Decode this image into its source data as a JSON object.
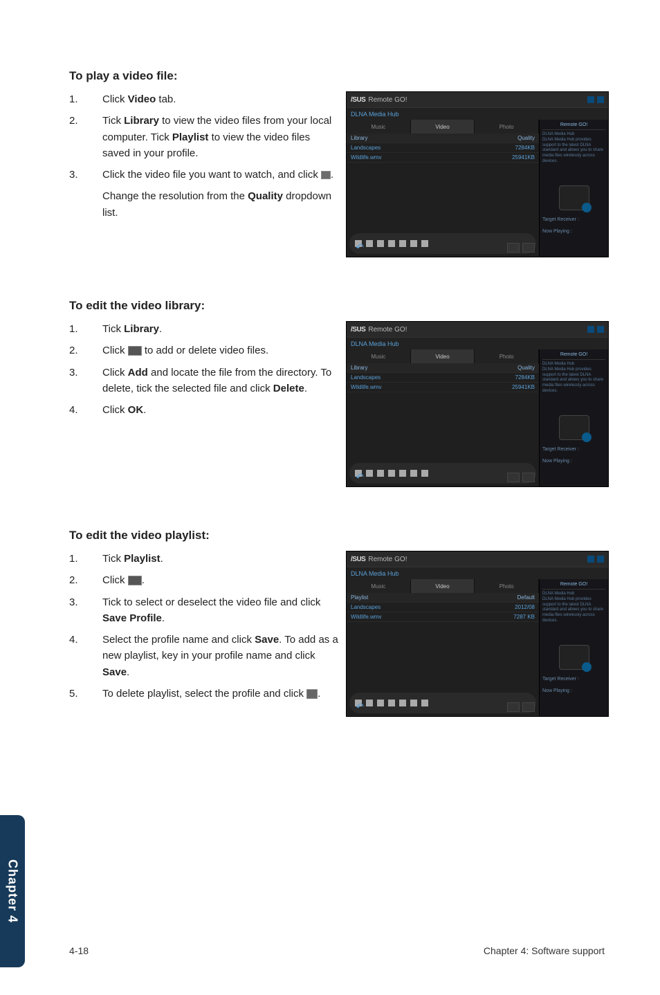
{
  "sidetab": "Chapter 4",
  "footer": {
    "left": "4-18",
    "right": "Chapter 4: Software support"
  },
  "sec1": {
    "heading": "To play a video file:",
    "items": [
      {
        "n": "1.",
        "pre": "Click ",
        "b1": "Video",
        "post": " tab."
      },
      {
        "n": "2.",
        "pre": "Tick ",
        "b1": "Library",
        "mid1": " to view the video files from your local computer. Tick ",
        "b2": "Playlist",
        "post": " to view the video files saved in your profile."
      },
      {
        "n": "3.",
        "pre": "Click the video file you want to watch, and click ",
        "icon": "play",
        "post": "."
      }
    ],
    "extra": {
      "pre": "Change the resolution from the ",
      "b1": "Quality",
      "post": " dropdown list."
    }
  },
  "sec2": {
    "heading": "To edit the video library:",
    "items": [
      {
        "n": "1.",
        "pre": "Tick ",
        "b1": "Library",
        "post": "."
      },
      {
        "n": "2.",
        "pre": "Click ",
        "icon": "btn",
        "post": " to add or delete video files."
      },
      {
        "n": "3.",
        "pre": "Click ",
        "b1": "Add",
        "mid1": " and locate the file from the directory. To delete, tick the selected file and click ",
        "b2": "Delete",
        "post": "."
      },
      {
        "n": "4.",
        "pre": "Click ",
        "b1": "OK",
        "post": "."
      }
    ]
  },
  "sec3": {
    "heading": "To edit the video playlist:",
    "items": [
      {
        "n": "1.",
        "pre": "Tick ",
        "b1": "Playlist",
        "post": "."
      },
      {
        "n": "2.",
        "pre": "Click ",
        "icon": "btn",
        "post": "."
      },
      {
        "n": "3.",
        "pre": "Tick to select or deselect the video file and click ",
        "b1": "Save Profile",
        "post": "."
      },
      {
        "n": "4.",
        "pre": "Select the profile name and click ",
        "b1": "Save",
        "mid1": ". To add as a new playlist, key in your profile name and click ",
        "b2": "Save",
        "post": "."
      },
      {
        "n": "5.",
        "pre": "To delete playlist, select the profile and click ",
        "icon": "trash",
        "post": "."
      }
    ]
  },
  "shot": {
    "brand": "/SUS",
    "title": "Remote GO!",
    "subtitle": "DLNA Media Hub",
    "tabs": [
      "Music",
      "Video",
      "Photo"
    ],
    "rows": [
      {
        "c1": "Library",
        "c2": ""
      },
      {
        "c1": "Library",
        "c2": "Quality"
      },
      {
        "c1": "Landscapes",
        "c2": "7284KB"
      },
      {
        "c1": "Wildlife.wmv",
        "c2": "25941KB"
      }
    ],
    "side": {
      "title1": "Remote GO!",
      "head1": "DLNA Media Hub",
      "desc1": "DLNA Media Hub provides support to the latest DLNA standard and allows you to share media files wirelessly across devices.",
      "label1": "Target Receiver :",
      "label2": "Now Playing :"
    },
    "shot3_rows": [
      {
        "c1": "Library",
        "c2": ""
      },
      {
        "c1": "Playlist",
        "c2": "Default"
      },
      {
        "c1": "Landscapes",
        "c2": "2012/08"
      },
      {
        "c1": "Wildlife.wmv",
        "c2": "7287 KB"
      }
    ]
  }
}
